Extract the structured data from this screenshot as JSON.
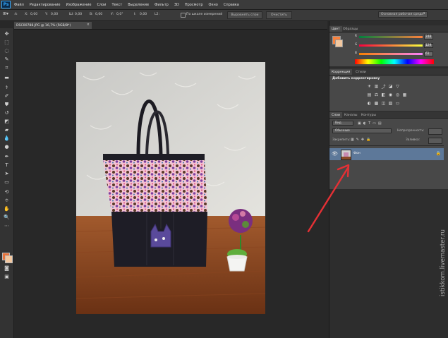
{
  "app": {
    "logo": "Ps"
  },
  "menu": [
    "Файл",
    "Редактирование",
    "Изображение",
    "Слои",
    "Текст",
    "Выделение",
    "Фильтр",
    "3D",
    "Просмотр",
    "Окно",
    "Справка"
  ],
  "options": {
    "x_label": "X:",
    "x_val": "0,00",
    "y_label": "Y:",
    "y_val": "0,00",
    "w_label": "Ш:",
    "w_val": "0,00",
    "h_label": "В:",
    "h_val": "0,00",
    "angle_label": "У:",
    "angle_val": "0,0°",
    "i_label": "I:",
    "i_val": "0,00",
    "l2_label": "L2:",
    "scale_checkbox": "По шкале измерений",
    "align_button": "Выровнять слои",
    "clear_button": "Очистить",
    "workspace": "Основная рабочая среда"
  },
  "document": {
    "tab_title": "DSC00788.JPG @ 16,7% (RGB/8*)",
    "close": "×"
  },
  "color_panel": {
    "tabs": [
      "Цвет",
      "Образцы"
    ],
    "r_label": "R",
    "r_val": "248",
    "g_label": "G",
    "g_val": "129",
    "b_label": "B",
    "b_val": "61",
    "fg_color": "#f8813d"
  },
  "adjust_panel": {
    "tabs": [
      "Коррекция",
      "Стили"
    ],
    "heading": "Добавить корректировку"
  },
  "layers_panel": {
    "tabs": [
      "Слои",
      "Каналы",
      "Контуры"
    ],
    "kind": "Вид",
    "blend": "Обычные",
    "opacity_label": "Непрозрачность:",
    "lock_label": "Закрепить:",
    "fill_label": "Заливка:",
    "layer_name": "Фон"
  },
  "watermark": "istikkom.livemaster.ru"
}
